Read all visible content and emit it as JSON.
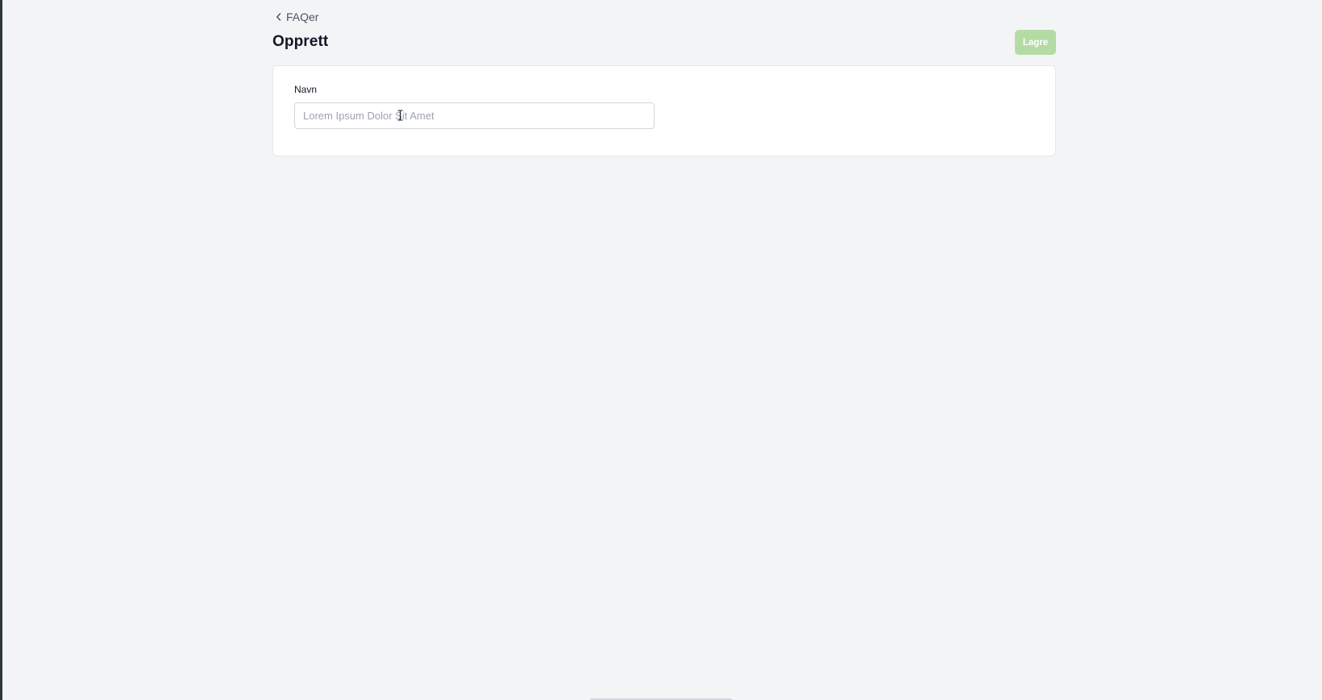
{
  "breadcrumb": {
    "back_label": "FAQer"
  },
  "header": {
    "title": "Opprett",
    "save_label": "Lagre"
  },
  "form": {
    "name_label": "Navn",
    "name_placeholder": "Lorem Ipsum Dolor Sit Amet",
    "name_value": ""
  },
  "icons": {
    "back": "chevron-left-icon",
    "cursor": "text-cursor-icon"
  },
  "colors": {
    "background": "#f3f4f6",
    "save_button": "#b5dba5",
    "card": "#ffffff"
  }
}
